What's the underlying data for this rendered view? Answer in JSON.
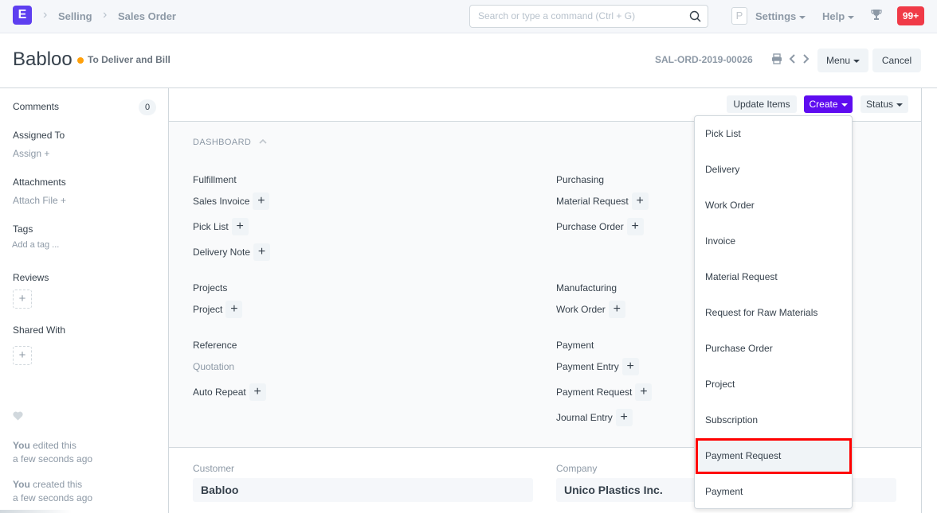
{
  "navbar": {
    "logo_letter": "E",
    "breadcrumbs": [
      "Selling",
      "Sales Order"
    ],
    "search_placeholder": "Search or type a command (Ctrl + G)",
    "avatar_letter": "P",
    "settings_label": "Settings",
    "help_label": "Help",
    "notification_count": "99+"
  },
  "page_head": {
    "title": "Babloo",
    "status": "To Deliver and Bill",
    "status_color": "#ffa00a",
    "doc_id": "SAL-ORD-2019-00026",
    "menu_label": "Menu",
    "cancel_label": "Cancel"
  },
  "sidebar": {
    "comments_label": "Comments",
    "comments_count": "0",
    "assigned_to_label": "Assigned To",
    "assign_link": "Assign +",
    "attachments_label": "Attachments",
    "attach_link": "Attach File +",
    "tags_label": "Tags",
    "add_tag_link": "Add a tag ...",
    "reviews_label": "Reviews",
    "shared_with_label": "Shared With",
    "activity": [
      {
        "who": "You",
        "action": " edited this",
        "when": "a few seconds ago"
      },
      {
        "who": "You",
        "action": " created this",
        "when": "a few seconds ago"
      }
    ]
  },
  "toolbar": {
    "update_items_label": "Update Items",
    "create_label": "Create",
    "status_label": "Status",
    "primary_color": "#5e0cf0"
  },
  "dashboard": {
    "title": "DASHBOARD",
    "groups": [
      {
        "title": "Fulfillment",
        "links": [
          {
            "label": "Sales Invoice",
            "add": true
          },
          {
            "label": "Pick List",
            "add": true
          },
          {
            "label": "Delivery Note",
            "add": true
          }
        ]
      },
      {
        "title": "Purchasing",
        "links": [
          {
            "label": "Material Request",
            "add": true
          },
          {
            "label": "Purchase Order",
            "add": true
          }
        ]
      },
      {
        "title": "Projects",
        "links": [
          {
            "label": "Project",
            "add": true
          }
        ]
      },
      {
        "title": "Manufacturing",
        "links": [
          {
            "label": "Work Order",
            "add": true
          }
        ]
      },
      {
        "title": "Reference",
        "links": [
          {
            "label": "Quotation",
            "add": false
          },
          {
            "label": "Auto Repeat",
            "add": true
          }
        ]
      },
      {
        "title": "Payment",
        "links": [
          {
            "label": "Payment Entry",
            "add": true
          },
          {
            "label": "Payment Request",
            "add": true
          },
          {
            "label": "Journal Entry",
            "add": true
          }
        ]
      }
    ]
  },
  "fields": {
    "customer_label": "Customer",
    "customer_value": "Babloo",
    "company_label": "Company",
    "company_value": "Unico Plastics Inc."
  },
  "create_menu": {
    "items": [
      "Pick List",
      "Delivery",
      "Work Order",
      "Invoice",
      "Material Request",
      "Request for Raw Materials",
      "Purchase Order",
      "Project",
      "Subscription",
      "Payment Request",
      "Payment"
    ],
    "highlighted": "Payment Request"
  }
}
